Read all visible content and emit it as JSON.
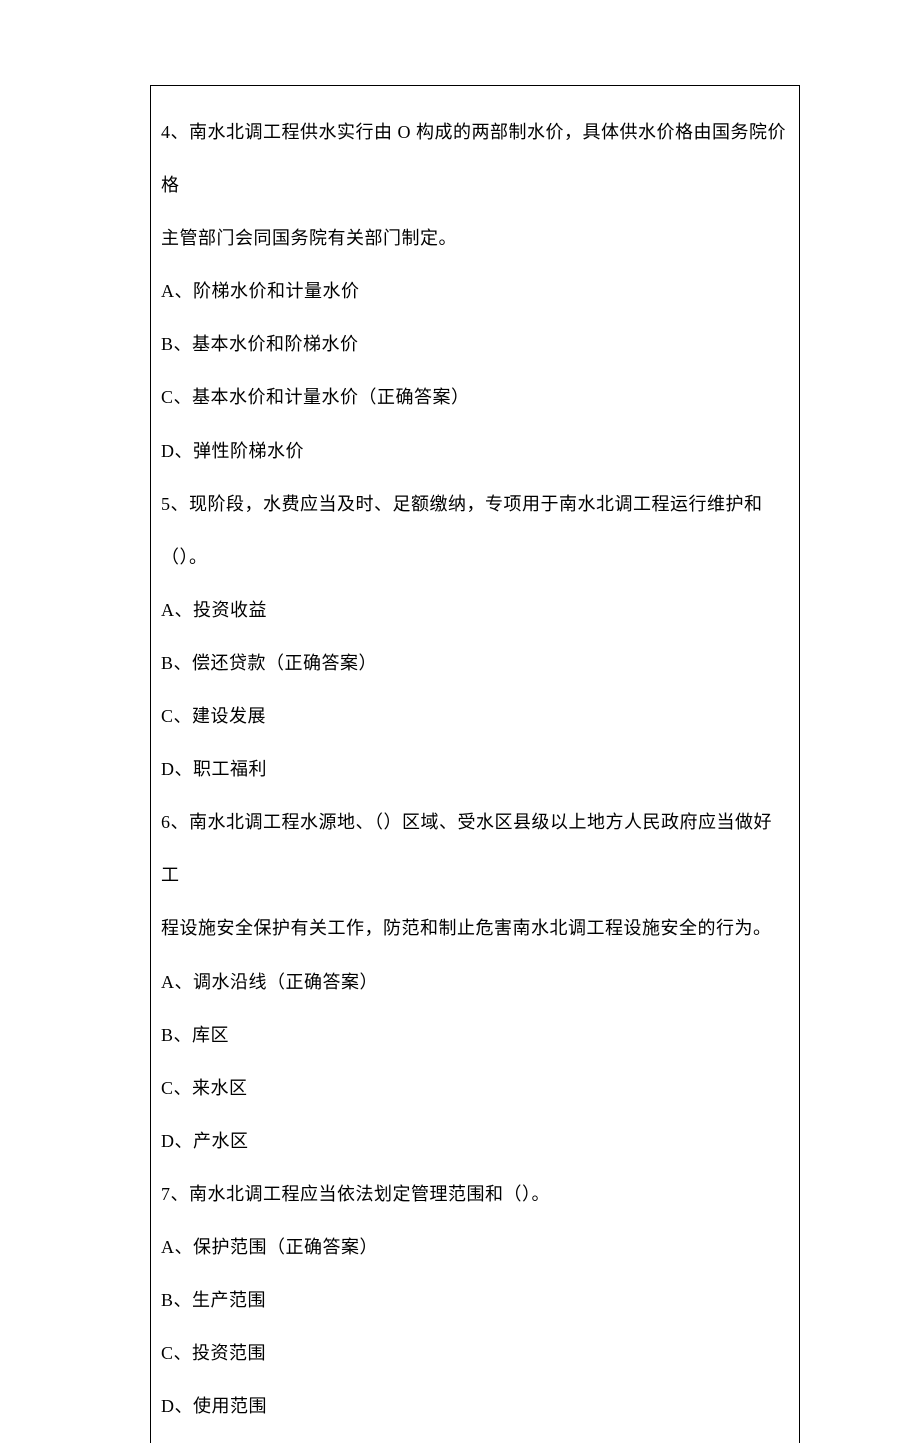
{
  "lines": [
    "4、南水北调工程供水实行由 O 构成的两部制水价，具体供水价格由国务院价格",
    "主管部门会同国务院有关部门制定。",
    "A、阶梯水价和计量水价",
    "B、基本水价和阶梯水价",
    "C、基本水价和计量水价（正确答案）",
    "D、弹性阶梯水价",
    "5、现阶段，水费应当及时、足额缴纳，专项用于南水北调工程运行维护和（）。",
    "A、投资收益",
    "B、偿还贷款（正确答案）",
    "C、建设发展",
    "D、职工福利",
    "6、南水北调工程水源地、（）区域、受水区县级以上地方人民政府应当做好工",
    "程设施安全保护有关工作，防范和制止危害南水北调工程设施安全的行为。",
    "A、调水沿线（正确答案）",
    "B、库区",
    "C、来水区",
    "D、产水区",
    "7、南水北调工程应当依法划定管理范围和（）。",
    "A、保护范围（正确答案）",
    "B、生产范围",
    "C、投资范围",
    "D、使用范围"
  ]
}
